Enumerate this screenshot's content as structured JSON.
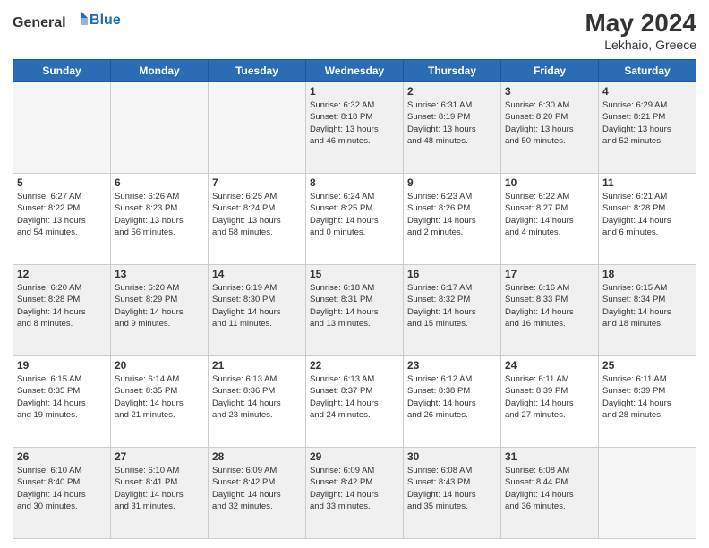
{
  "header": {
    "logo_general": "General",
    "logo_blue": "Blue",
    "month_year": "May 2024",
    "location": "Lekhaio, Greece"
  },
  "days_of_week": [
    "Sunday",
    "Monday",
    "Tuesday",
    "Wednesday",
    "Thursday",
    "Friday",
    "Saturday"
  ],
  "weeks": [
    [
      {
        "day": "",
        "empty": true
      },
      {
        "day": "",
        "empty": true
      },
      {
        "day": "",
        "empty": true
      },
      {
        "day": "1",
        "line1": "Sunrise: 6:32 AM",
        "line2": "Sunset: 8:18 PM",
        "line3": "Daylight: 13 hours",
        "line4": "and 46 minutes."
      },
      {
        "day": "2",
        "line1": "Sunrise: 6:31 AM",
        "line2": "Sunset: 8:19 PM",
        "line3": "Daylight: 13 hours",
        "line4": "and 48 minutes."
      },
      {
        "day": "3",
        "line1": "Sunrise: 6:30 AM",
        "line2": "Sunset: 8:20 PM",
        "line3": "Daylight: 13 hours",
        "line4": "and 50 minutes."
      },
      {
        "day": "4",
        "line1": "Sunrise: 6:29 AM",
        "line2": "Sunset: 8:21 PM",
        "line3": "Daylight: 13 hours",
        "line4": "and 52 minutes."
      }
    ],
    [
      {
        "day": "5",
        "line1": "Sunrise: 6:27 AM",
        "line2": "Sunset: 8:22 PM",
        "line3": "Daylight: 13 hours",
        "line4": "and 54 minutes."
      },
      {
        "day": "6",
        "line1": "Sunrise: 6:26 AM",
        "line2": "Sunset: 8:23 PM",
        "line3": "Daylight: 13 hours",
        "line4": "and 56 minutes."
      },
      {
        "day": "7",
        "line1": "Sunrise: 6:25 AM",
        "line2": "Sunset: 8:24 PM",
        "line3": "Daylight: 13 hours",
        "line4": "and 58 minutes."
      },
      {
        "day": "8",
        "line1": "Sunrise: 6:24 AM",
        "line2": "Sunset: 8:25 PM",
        "line3": "Daylight: 14 hours",
        "line4": "and 0 minutes."
      },
      {
        "day": "9",
        "line1": "Sunrise: 6:23 AM",
        "line2": "Sunset: 8:26 PM",
        "line3": "Daylight: 14 hours",
        "line4": "and 2 minutes."
      },
      {
        "day": "10",
        "line1": "Sunrise: 6:22 AM",
        "line2": "Sunset: 8:27 PM",
        "line3": "Daylight: 14 hours",
        "line4": "and 4 minutes."
      },
      {
        "day": "11",
        "line1": "Sunrise: 6:21 AM",
        "line2": "Sunset: 8:28 PM",
        "line3": "Daylight: 14 hours",
        "line4": "and 6 minutes."
      }
    ],
    [
      {
        "day": "12",
        "line1": "Sunrise: 6:20 AM",
        "line2": "Sunset: 8:28 PM",
        "line3": "Daylight: 14 hours",
        "line4": "and 8 minutes."
      },
      {
        "day": "13",
        "line1": "Sunrise: 6:20 AM",
        "line2": "Sunset: 8:29 PM",
        "line3": "Daylight: 14 hours",
        "line4": "and 9 minutes."
      },
      {
        "day": "14",
        "line1": "Sunrise: 6:19 AM",
        "line2": "Sunset: 8:30 PM",
        "line3": "Daylight: 14 hours",
        "line4": "and 11 minutes."
      },
      {
        "day": "15",
        "line1": "Sunrise: 6:18 AM",
        "line2": "Sunset: 8:31 PM",
        "line3": "Daylight: 14 hours",
        "line4": "and 13 minutes."
      },
      {
        "day": "16",
        "line1": "Sunrise: 6:17 AM",
        "line2": "Sunset: 8:32 PM",
        "line3": "Daylight: 14 hours",
        "line4": "and 15 minutes."
      },
      {
        "day": "17",
        "line1": "Sunrise: 6:16 AM",
        "line2": "Sunset: 8:33 PM",
        "line3": "Daylight: 14 hours",
        "line4": "and 16 minutes."
      },
      {
        "day": "18",
        "line1": "Sunrise: 6:15 AM",
        "line2": "Sunset: 8:34 PM",
        "line3": "Daylight: 14 hours",
        "line4": "and 18 minutes."
      }
    ],
    [
      {
        "day": "19",
        "line1": "Sunrise: 6:15 AM",
        "line2": "Sunset: 8:35 PM",
        "line3": "Daylight: 14 hours",
        "line4": "and 19 minutes."
      },
      {
        "day": "20",
        "line1": "Sunrise: 6:14 AM",
        "line2": "Sunset: 8:35 PM",
        "line3": "Daylight: 14 hours",
        "line4": "and 21 minutes."
      },
      {
        "day": "21",
        "line1": "Sunrise: 6:13 AM",
        "line2": "Sunset: 8:36 PM",
        "line3": "Daylight: 14 hours",
        "line4": "and 23 minutes."
      },
      {
        "day": "22",
        "line1": "Sunrise: 6:13 AM",
        "line2": "Sunset: 8:37 PM",
        "line3": "Daylight: 14 hours",
        "line4": "and 24 minutes."
      },
      {
        "day": "23",
        "line1": "Sunrise: 6:12 AM",
        "line2": "Sunset: 8:38 PM",
        "line3": "Daylight: 14 hours",
        "line4": "and 26 minutes."
      },
      {
        "day": "24",
        "line1": "Sunrise: 6:11 AM",
        "line2": "Sunset: 8:39 PM",
        "line3": "Daylight: 14 hours",
        "line4": "and 27 minutes."
      },
      {
        "day": "25",
        "line1": "Sunrise: 6:11 AM",
        "line2": "Sunset: 8:39 PM",
        "line3": "Daylight: 14 hours",
        "line4": "and 28 minutes."
      }
    ],
    [
      {
        "day": "26",
        "line1": "Sunrise: 6:10 AM",
        "line2": "Sunset: 8:40 PM",
        "line3": "Daylight: 14 hours",
        "line4": "and 30 minutes."
      },
      {
        "day": "27",
        "line1": "Sunrise: 6:10 AM",
        "line2": "Sunset: 8:41 PM",
        "line3": "Daylight: 14 hours",
        "line4": "and 31 minutes."
      },
      {
        "day": "28",
        "line1": "Sunrise: 6:09 AM",
        "line2": "Sunset: 8:42 PM",
        "line3": "Daylight: 14 hours",
        "line4": "and 32 minutes."
      },
      {
        "day": "29",
        "line1": "Sunrise: 6:09 AM",
        "line2": "Sunset: 8:42 PM",
        "line3": "Daylight: 14 hours",
        "line4": "and 33 minutes."
      },
      {
        "day": "30",
        "line1": "Sunrise: 6:08 AM",
        "line2": "Sunset: 8:43 PM",
        "line3": "Daylight: 14 hours",
        "line4": "and 35 minutes."
      },
      {
        "day": "31",
        "line1": "Sunrise: 6:08 AM",
        "line2": "Sunset: 8:44 PM",
        "line3": "Daylight: 14 hours",
        "line4": "and 36 minutes."
      },
      {
        "day": "",
        "empty": true
      }
    ]
  ]
}
